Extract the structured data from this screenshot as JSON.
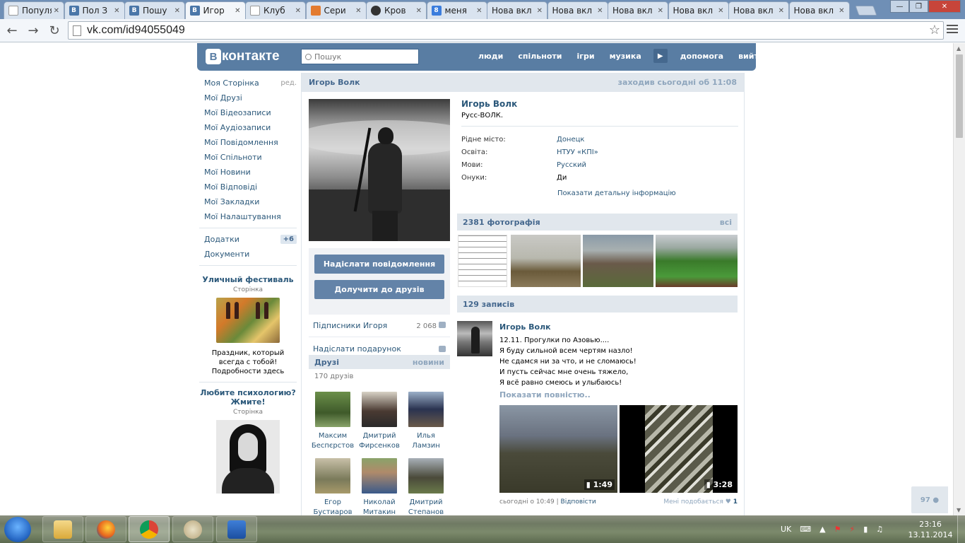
{
  "browser": {
    "tabs": [
      {
        "title": "Популя",
        "favicon": "doc"
      },
      {
        "title": "Пол З",
        "favicon": "vk"
      },
      {
        "title": "Пошу",
        "favicon": "vk"
      },
      {
        "title": "Игор",
        "favicon": "vk",
        "active": true
      },
      {
        "title": "Клуб",
        "favicon": "doc"
      },
      {
        "title": "Сери",
        "favicon": "fox"
      },
      {
        "title": "Кров",
        "favicon": "face"
      },
      {
        "title": "меня",
        "favicon": "g"
      },
      {
        "title": "Нова вкл",
        "favicon": "none"
      },
      {
        "title": "Нова вкл",
        "favicon": "none"
      },
      {
        "title": "Нова вкл",
        "favicon": "none"
      },
      {
        "title": "Нова вкл",
        "favicon": "none"
      },
      {
        "title": "Нова вкл",
        "favicon": "none"
      },
      {
        "title": "Нова вкл",
        "favicon": "none"
      }
    ],
    "url": "vk.com/id94055049"
  },
  "header": {
    "logo_letter": "В",
    "logo_text": "контакте",
    "search_placeholder": "Пошук",
    "nav": [
      "люди",
      "спільноти",
      "ігри",
      "музика",
      "допомога",
      "вийти"
    ]
  },
  "leftmenu": {
    "items": [
      {
        "label": "Моя Сторінка",
        "extra": "ред."
      },
      {
        "label": "Мої Друзі"
      },
      {
        "label": "Мої Відеозаписи"
      },
      {
        "label": "Мої Аудіозаписи"
      },
      {
        "label": "Мої Повідомлення"
      },
      {
        "label": "Мої Спільноти"
      },
      {
        "label": "Мої Новини"
      },
      {
        "label": "Мої Відповіді"
      },
      {
        "label": "Мої Закладки"
      },
      {
        "label": "Мої Налаштування"
      }
    ],
    "extra_items": [
      {
        "label": "Додатки",
        "badge": "+6"
      },
      {
        "label": "Документи"
      }
    ],
    "ads": [
      {
        "title": "Уличный фестиваль",
        "kind": "Сторінка",
        "desc": "Праздник, который всегда с тобой! Подробности здесь"
      },
      {
        "title": "Любите психологию? Жмите!",
        "kind": "Сторінка",
        "desc": ""
      }
    ]
  },
  "profile": {
    "head_name": "Игорь Волк",
    "last_seen": "заходив сьогодні об 11:08",
    "name": "Игорь Волк",
    "status": "Русс-ВОЛК.",
    "fields": [
      {
        "key": "Рідне місто:",
        "value": "Донецк",
        "link": true
      },
      {
        "key": "Освіта:",
        "value": "НТУУ «КПІ»",
        "link": true
      },
      {
        "key": "Мови:",
        "value": "Русский",
        "link": true
      },
      {
        "key": "Онуки:",
        "value": "Ди",
        "link": false
      }
    ],
    "more_info": "Показати детальну інформацію",
    "send_message": "Надіслати повідомлення",
    "add_friend": "Долучити до друзів",
    "followers_label": "Підписники Игоря",
    "followers_count": "2 068",
    "gift_label": "Надіслати подарунок",
    "friends_title": "Друзі",
    "friends_new": "новини",
    "friends_count": "170 друзів",
    "friends": [
      {
        "name": "Максим Беспєрстов"
      },
      {
        "name": "Дмитрий Фирсенков"
      },
      {
        "name": "Илья Ламзин"
      },
      {
        "name": "Егор Бустиаров"
      },
      {
        "name": "Николай Митакин"
      },
      {
        "name": "Дмитрий Степанов"
      }
    ],
    "photos_title": "2381 фотографія",
    "photos_all": "всі",
    "posts_title": "129 записів",
    "post": {
      "author": "Игорь Волк",
      "lines": [
        "12.11. Прогулки по Азовью....",
        "Я буду сильной всем чертям назло!",
        "Не сдамся ни за что, и не сломаюсь!",
        "И пусть сейчас мне очень тяжело,",
        "Я всё равно смеюсь и улыбаюсь!"
      ],
      "show_full": "Показати повністю..",
      "videos": [
        {
          "duration": "1:49"
        },
        {
          "duration": "3:28"
        }
      ],
      "time": "сьогодні о 10:49",
      "reply": "Відповісти",
      "likes_label": "Мені подобається",
      "likes": "1"
    }
  },
  "online_count": "97",
  "taskbar": {
    "lang": "UK",
    "time": "23:16",
    "date": "13.11.2014"
  }
}
